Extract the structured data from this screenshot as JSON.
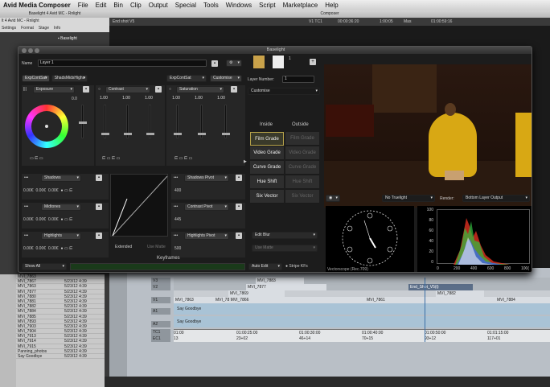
{
  "menubar": {
    "app": "Avid Media Composer",
    "items": [
      "File",
      "Edit",
      "Bin",
      "Clip",
      "Output",
      "Special",
      "Tools",
      "Windows",
      "Script",
      "Marketplace",
      "Help"
    ]
  },
  "bin_window": {
    "title": "Baselight 4 Avid MC - Rnlight",
    "tab": "lt 4 Avid MC - Rnlight",
    "toolbar": [
      "Settings",
      "Format",
      "Stage",
      "Info"
    ],
    "item": "Baselight"
  },
  "composer": {
    "title": "Composer",
    "clip": "End shot V5",
    "tc1": "V1 TC1",
    "tc_vals": [
      "00:00:36:20",
      "1:00:05",
      "Mas",
      "01:00:59:16"
    ]
  },
  "baselight": {
    "title": "Baselight",
    "name_label": "Name",
    "name_value": "Layer 1",
    "tabs_left": [
      "ExpContSat",
      "ShadsMidsHighs"
    ],
    "tabs_right": [
      "ExpContSat",
      "Customise"
    ],
    "exposure": {
      "label": "Exposure",
      "value": "0.0"
    },
    "contrast": {
      "label": "Contrast",
      "values": [
        "1.00",
        "1.00",
        "1.00"
      ]
    },
    "saturation": {
      "label": "Saturation",
      "values": [
        "1.00",
        "1.00",
        "1.00"
      ]
    },
    "shadows": {
      "label": "Shadows",
      "values": [
        "0.00€",
        "0.00€",
        "0.00€"
      ]
    },
    "midtones": {
      "label": "Midtones",
      "values": [
        "0.00€",
        "0.00€",
        "0.00€"
      ]
    },
    "highlights": {
      "label": "Highlights",
      "values": [
        "0.00€",
        "0.00€",
        "0.00€"
      ]
    },
    "shadows_pivot": {
      "label": "Shadows Pivot",
      "value": "400"
    },
    "contrast_pivot": {
      "label": "Contrast Pivot",
      "value": "445"
    },
    "highlights_pivot": {
      "label": "Highlights Pivot",
      "value": "500"
    },
    "extended": "Extended",
    "use_matte": "Use Matte",
    "keyframes": "Keyframes",
    "show_all": "Show All",
    "layer_number_label": "Layer Number:",
    "layer_number": "1",
    "customise": "Customise",
    "layer_count": "1",
    "inside": "Inside",
    "outside": "Outside",
    "grades": [
      [
        "Film Grade",
        "Film Grade"
      ],
      [
        "Video Grade",
        "Video Grade"
      ],
      [
        "Curve Grade",
        "Curve Grade"
      ],
      [
        "Hue Shift",
        "Hue Shift"
      ],
      [
        "Six Vector",
        "Six Vector"
      ]
    ],
    "edit_blur": "Edit Blur",
    "use_matte2": "Use Matte",
    "auto_edit": "Auto Edit",
    "stripe_kfs": "Stripe KFs",
    "truelight": "No Truelight",
    "render_label": "Render:",
    "render_value": "Bottom Layer Output",
    "vectorscope": "Vectorscope (Rec.709)",
    "hist_y": [
      "100",
      "80",
      "60",
      "40",
      "20",
      "0"
    ],
    "hist_x": [
      "0",
      "200",
      "400",
      "600",
      "800",
      "100("
    ]
  },
  "bin_list": [
    [
      "MVI_7863",
      ""
    ],
    [
      "MVI_7867",
      "5/23/12 4:39"
    ],
    [
      "MVI_7863",
      "5/23/12 4:39"
    ],
    [
      "MVI_7877",
      "5/23/12 4:39"
    ],
    [
      "MVI_7880",
      "5/23/12 4:39"
    ],
    [
      "MVI_7881",
      "5/23/12 4:39"
    ],
    [
      "MVI_7882",
      "5/23/12 4:39"
    ],
    [
      "MVI_7884",
      "5/23/12 4:39"
    ],
    [
      "MVI_7885",
      "5/23/12 4:39"
    ],
    [
      "MVI_7893",
      "5/23/12 4:39"
    ],
    [
      "MVI_7903",
      "5/23/12 4:39"
    ],
    [
      "MVI_7904",
      "5/23/12 4:39"
    ],
    [
      "MVI_7913",
      "5/23/12 4:39"
    ],
    [
      "MVI_7914",
      "5/23/12 4:39"
    ],
    [
      "MVI_7915",
      "5/23/12 4:39"
    ],
    [
      "Panning_photos",
      "5/23/12 4:39"
    ],
    [
      "Say Goodbye",
      "5/23/12 4:39"
    ]
  ],
  "timeline": {
    "tracks": [
      "V3",
      "V2",
      "V1",
      "A1",
      "A2",
      "TC1",
      "EC1"
    ],
    "v3": "MVI_7883",
    "v2": [
      "MVI_7877",
      "End_Shot_V5(t)"
    ],
    "v1": [
      "MVI_7863",
      "MVI_7869",
      "MVI_78 MVI_7866",
      "MVI_7861",
      "MVI_7884"
    ],
    "mvi7882": "MVI_7882",
    "audio": "Say Goodbye",
    "tc": [
      "01:00",
      "01:00:25:00",
      "01:00:30:00",
      "01:00:40:00",
      "01:00:50:00",
      "01:01:15:00",
      "01:"
    ],
    "ec": [
      "13",
      "23+02",
      "46+14",
      "70+15",
      "93+12",
      "117+01",
      "140"
    ]
  }
}
